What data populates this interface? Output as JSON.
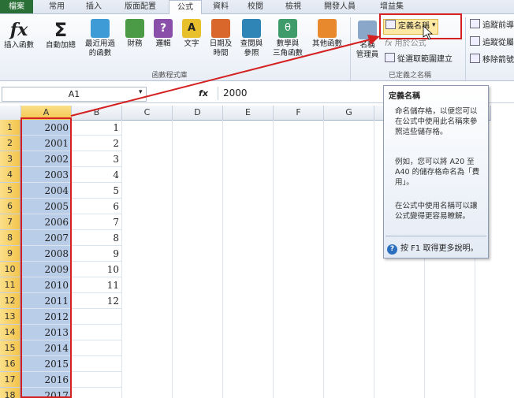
{
  "tabs": [
    "檔案",
    "常用",
    "插入",
    "版面配置",
    "公式",
    "資料",
    "校閱",
    "檢視",
    "開發人員",
    "增益集"
  ],
  "ribbon": {
    "insert_function": "插入函數",
    "autosum": "自動加總",
    "recent_line1": "最近用過",
    "recent_line2": "的函數",
    "financial": "財務",
    "logical": "邏輯",
    "text": "文字",
    "datetime_line1": "日期及",
    "datetime_line2": "時間",
    "lookup_line1": "查閱與",
    "lookup_line2": "參照",
    "math_line1": "數學與",
    "math_line2": "三角函數",
    "more_line1": "其他函數",
    "library_group": "函數程式庫",
    "name_manager_line1": "名稱",
    "name_manager_line2": "管理員",
    "define_name": "定義名稱",
    "use_in_formula": "用於公式",
    "create_from_selection": "從選取範圍建立",
    "defined_names_group": "已定義之名稱",
    "trace_precedents": "追蹤前導",
    "trace_dependents": "追蹤從屬",
    "remove_arrows": "移除箭號"
  },
  "formula_bar": {
    "name_box": "A1",
    "fx": "fx",
    "value": "2000"
  },
  "columns": [
    "A",
    "B",
    "C",
    "D",
    "E",
    "F",
    "G",
    "H",
    "I",
    "J"
  ],
  "rows": [
    "1",
    "2",
    "3",
    "4",
    "5",
    "6",
    "7",
    "8",
    "9",
    "10",
    "11",
    "12",
    "13",
    "14",
    "15",
    "16",
    "17",
    "18"
  ],
  "col_a": [
    "2000",
    "2001",
    "2002",
    "2003",
    "2004",
    "2005",
    "2006",
    "2007",
    "2008",
    "2009",
    "2010",
    "2011",
    "2012",
    "2013",
    "2014",
    "2015",
    "2016",
    "2017"
  ],
  "col_b": [
    "1",
    "2",
    "3",
    "4",
    "5",
    "6",
    "7",
    "8",
    "9",
    "10",
    "11",
    "12"
  ],
  "tooltip": {
    "title": "定義名稱",
    "p1": "命名儲存格，以便您可以在公式中使用此名稱來參照這些儲存格。",
    "p2": "例如，您可以將 A20 至 A40 的儲存格命名為「費用」。",
    "p3": "在公式中使用名稱可以讓公式變得更容易瞭解。",
    "help": "按 F1 取得更多說明。"
  },
  "colors": {
    "highlight_red": "#d42020",
    "selection_blue": "#b9cde8",
    "header_selected": "#f3c44c",
    "file_tab": "#2a6f36"
  }
}
